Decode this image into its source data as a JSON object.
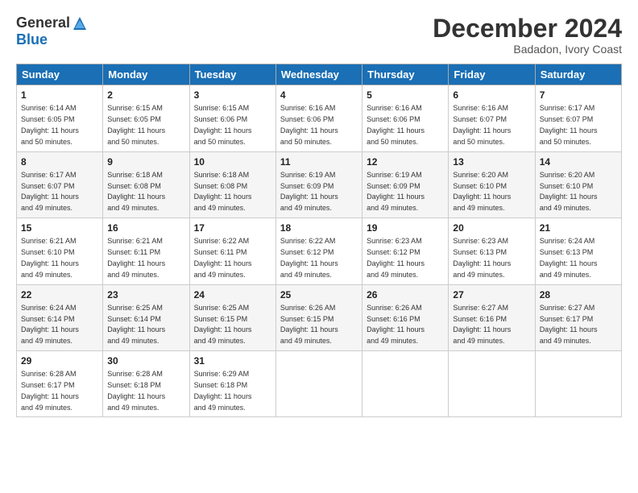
{
  "logo": {
    "general": "General",
    "blue": "Blue"
  },
  "title": "December 2024",
  "subtitle": "Badadon, Ivory Coast",
  "days": [
    "Sunday",
    "Monday",
    "Tuesday",
    "Wednesday",
    "Thursday",
    "Friday",
    "Saturday"
  ],
  "weeks": [
    [
      {
        "num": "1",
        "rise": "6:14 AM",
        "set": "6:05 PM",
        "hours": "11 hours and 50 minutes."
      },
      {
        "num": "2",
        "rise": "6:15 AM",
        "set": "6:05 PM",
        "hours": "11 hours and 50 minutes."
      },
      {
        "num": "3",
        "rise": "6:15 AM",
        "set": "6:06 PM",
        "hours": "11 hours and 50 minutes."
      },
      {
        "num": "4",
        "rise": "6:16 AM",
        "set": "6:06 PM",
        "hours": "11 hours and 50 minutes."
      },
      {
        "num": "5",
        "rise": "6:16 AM",
        "set": "6:06 PM",
        "hours": "11 hours and 50 minutes."
      },
      {
        "num": "6",
        "rise": "6:16 AM",
        "set": "6:07 PM",
        "hours": "11 hours and 50 minutes."
      },
      {
        "num": "7",
        "rise": "6:17 AM",
        "set": "6:07 PM",
        "hours": "11 hours and 50 minutes."
      }
    ],
    [
      {
        "num": "8",
        "rise": "6:17 AM",
        "set": "6:07 PM",
        "hours": "11 hours and 49 minutes."
      },
      {
        "num": "9",
        "rise": "6:18 AM",
        "set": "6:08 PM",
        "hours": "11 hours and 49 minutes."
      },
      {
        "num": "10",
        "rise": "6:18 AM",
        "set": "6:08 PM",
        "hours": "11 hours and 49 minutes."
      },
      {
        "num": "11",
        "rise": "6:19 AM",
        "set": "6:09 PM",
        "hours": "11 hours and 49 minutes."
      },
      {
        "num": "12",
        "rise": "6:19 AM",
        "set": "6:09 PM",
        "hours": "11 hours and 49 minutes."
      },
      {
        "num": "13",
        "rise": "6:20 AM",
        "set": "6:10 PM",
        "hours": "11 hours and 49 minutes."
      },
      {
        "num": "14",
        "rise": "6:20 AM",
        "set": "6:10 PM",
        "hours": "11 hours and 49 minutes."
      }
    ],
    [
      {
        "num": "15",
        "rise": "6:21 AM",
        "set": "6:10 PM",
        "hours": "11 hours and 49 minutes."
      },
      {
        "num": "16",
        "rise": "6:21 AM",
        "set": "6:11 PM",
        "hours": "11 hours and 49 minutes."
      },
      {
        "num": "17",
        "rise": "6:22 AM",
        "set": "6:11 PM",
        "hours": "11 hours and 49 minutes."
      },
      {
        "num": "18",
        "rise": "6:22 AM",
        "set": "6:12 PM",
        "hours": "11 hours and 49 minutes."
      },
      {
        "num": "19",
        "rise": "6:23 AM",
        "set": "6:12 PM",
        "hours": "11 hours and 49 minutes."
      },
      {
        "num": "20",
        "rise": "6:23 AM",
        "set": "6:13 PM",
        "hours": "11 hours and 49 minutes."
      },
      {
        "num": "21",
        "rise": "6:24 AM",
        "set": "6:13 PM",
        "hours": "11 hours and 49 minutes."
      }
    ],
    [
      {
        "num": "22",
        "rise": "6:24 AM",
        "set": "6:14 PM",
        "hours": "11 hours and 49 minutes."
      },
      {
        "num": "23",
        "rise": "6:25 AM",
        "set": "6:14 PM",
        "hours": "11 hours and 49 minutes."
      },
      {
        "num": "24",
        "rise": "6:25 AM",
        "set": "6:15 PM",
        "hours": "11 hours and 49 minutes."
      },
      {
        "num": "25",
        "rise": "6:26 AM",
        "set": "6:15 PM",
        "hours": "11 hours and 49 minutes."
      },
      {
        "num": "26",
        "rise": "6:26 AM",
        "set": "6:16 PM",
        "hours": "11 hours and 49 minutes."
      },
      {
        "num": "27",
        "rise": "6:27 AM",
        "set": "6:16 PM",
        "hours": "11 hours and 49 minutes."
      },
      {
        "num": "28",
        "rise": "6:27 AM",
        "set": "6:17 PM",
        "hours": "11 hours and 49 minutes."
      }
    ],
    [
      {
        "num": "29",
        "rise": "6:28 AM",
        "set": "6:17 PM",
        "hours": "11 hours and 49 minutes."
      },
      {
        "num": "30",
        "rise": "6:28 AM",
        "set": "6:18 PM",
        "hours": "11 hours and 49 minutes."
      },
      {
        "num": "31",
        "rise": "6:29 AM",
        "set": "6:18 PM",
        "hours": "11 hours and 49 minutes."
      },
      null,
      null,
      null,
      null
    ]
  ]
}
